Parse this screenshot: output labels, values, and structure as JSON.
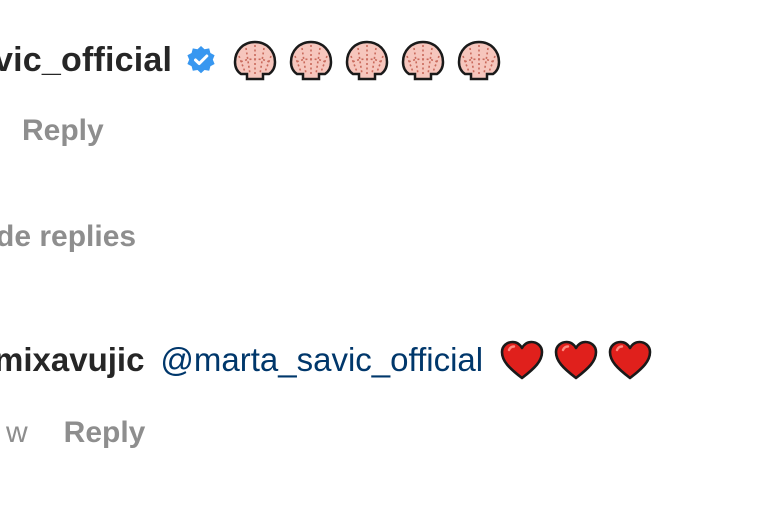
{
  "comment1": {
    "username": "vic_official",
    "verified": true,
    "emoji_count": 5,
    "reply_label": "Reply"
  },
  "thread": {
    "toggle_label": "de replies"
  },
  "comment2": {
    "username": "mixavujic",
    "mention": "@marta_savic_official",
    "emoji_count": 3,
    "time": "w",
    "reply_label": "Reply"
  },
  "colors": {
    "verified_blue": "#3897f0",
    "mention_blue": "#00376b",
    "secondary_gray": "#8e8e8e",
    "heart_red": "#e0201c"
  },
  "icons": {
    "verified": "verified-badge-icon",
    "shell": "shell-emoji-icon",
    "heart": "red-heart-emoji-icon"
  }
}
